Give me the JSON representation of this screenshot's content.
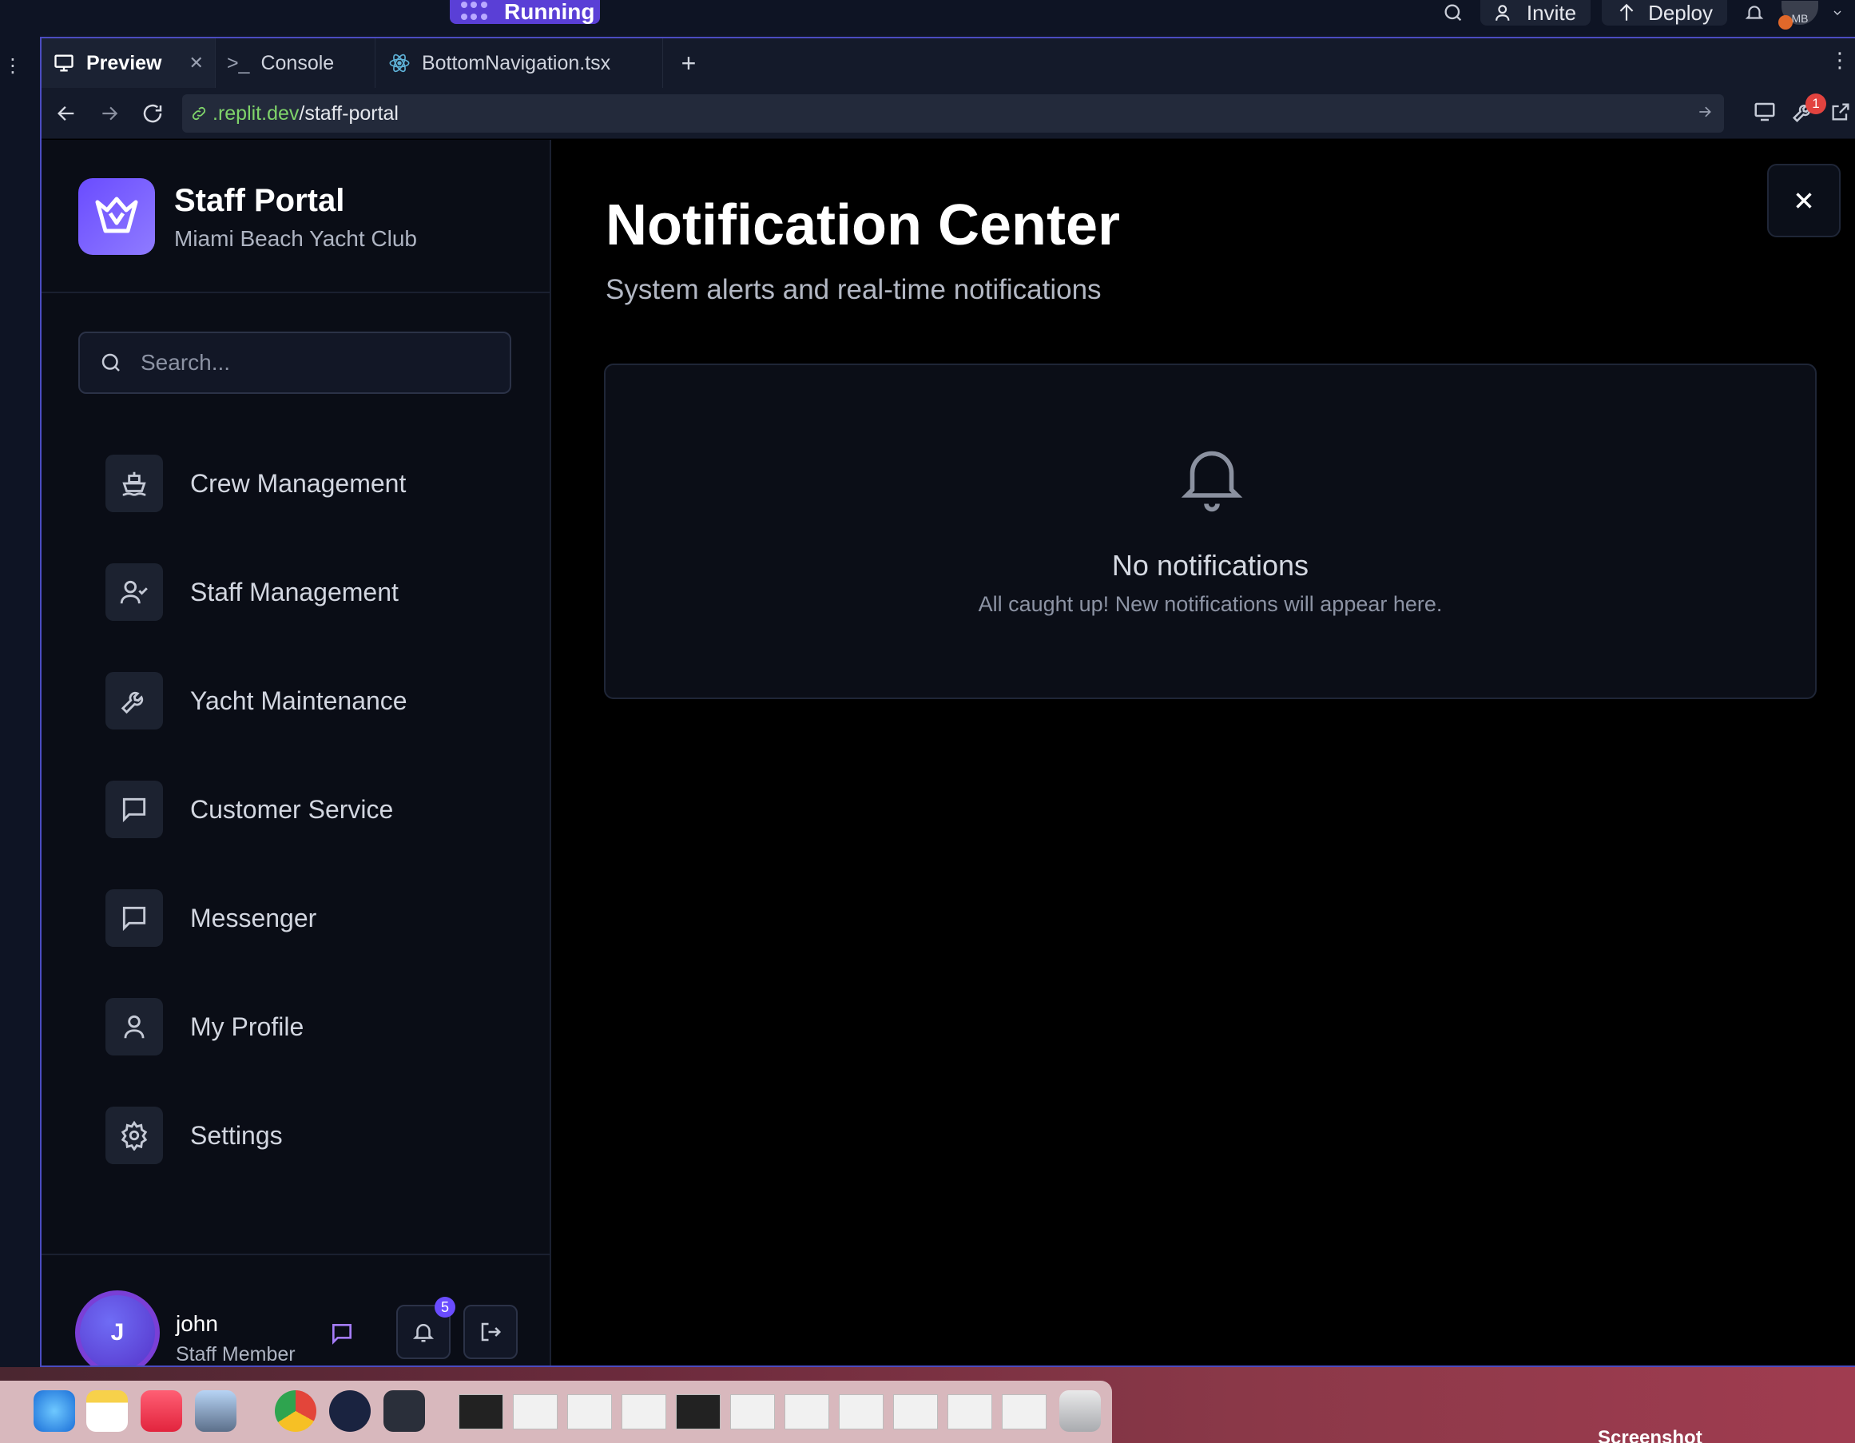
{
  "topbar": {
    "run_label": "Running",
    "invite_label": "Invite",
    "deploy_label": "Deploy",
    "avatar_initials": "MB"
  },
  "tabs": [
    {
      "label": "Preview"
    },
    {
      "label": "Console"
    },
    {
      "label": "BottomNavigation.tsx"
    }
  ],
  "url": {
    "domain": ".replit.dev",
    "path": "/staff-portal",
    "devtools_badge": "1"
  },
  "sidebar": {
    "title": "Staff Portal",
    "subtitle": "Miami Beach Yacht Club",
    "search_placeholder": "Search...",
    "items": [
      {
        "label": "Crew Management",
        "icon": "ship-icon"
      },
      {
        "label": "Staff Management",
        "icon": "user-check-icon"
      },
      {
        "label": "Yacht Maintenance",
        "icon": "wrench-icon"
      },
      {
        "label": "Customer Service",
        "icon": "message-square-icon"
      },
      {
        "label": "Messenger",
        "icon": "message-square-icon"
      },
      {
        "label": "My Profile",
        "icon": "user-icon"
      },
      {
        "label": "Settings",
        "icon": "gear-icon"
      }
    ],
    "user": {
      "initial": "J",
      "name": "john",
      "role": "Staff Member",
      "notification_count": "5"
    }
  },
  "main": {
    "title": "Notification Center",
    "subtitle": "System alerts and real-time notifications",
    "empty_title": "No notifications",
    "empty_subtitle": "All caught up! New notifications will appear here."
  },
  "dock": {
    "screenshot_label": "Screenshot"
  },
  "colors": {
    "accent": "#6a4cff",
    "url_domain": "#7fd36a",
    "badge_red": "#e2433f"
  }
}
